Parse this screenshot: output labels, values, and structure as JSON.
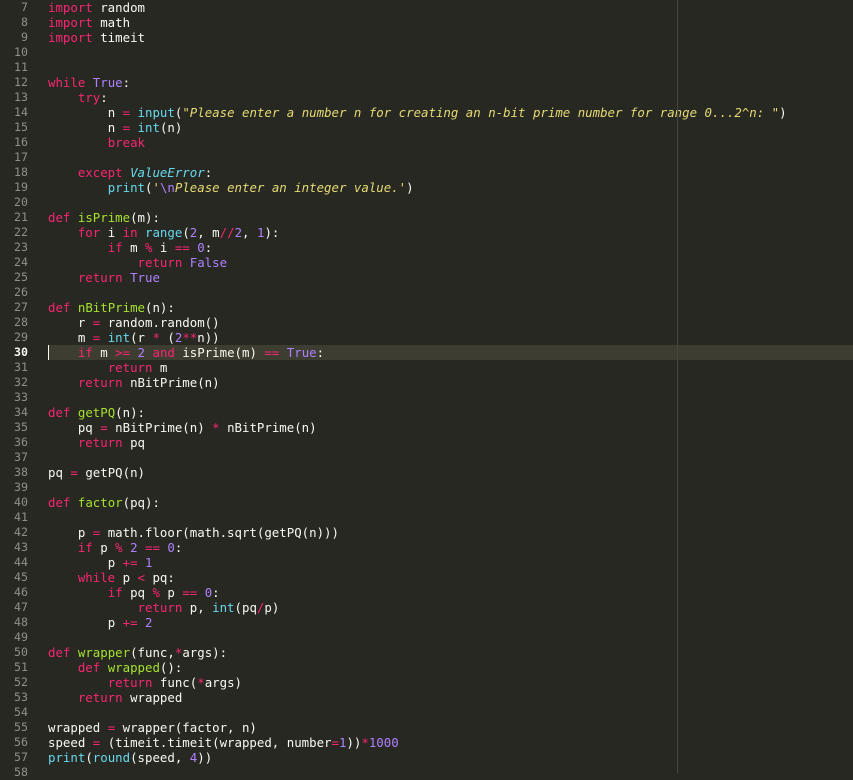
{
  "editor": {
    "active_line_number": "30",
    "colors": {
      "background": "#272822",
      "line_highlight": "#3e3d32",
      "gutter_text": "#90908a",
      "keyword": "#f92672",
      "string": "#e6db74",
      "number": "#ae81ff",
      "builtin": "#66d9ef",
      "function_name": "#a6e22e",
      "plain": "#f8f8f2"
    },
    "lines": [
      {
        "num": "7",
        "indent": 0,
        "tokens": [
          {
            "c": "k",
            "t": "import"
          },
          {
            "c": "t",
            "t": " random"
          }
        ]
      },
      {
        "num": "8",
        "indent": 0,
        "tokens": [
          {
            "c": "k",
            "t": "import"
          },
          {
            "c": "t",
            "t": " math"
          }
        ]
      },
      {
        "num": "9",
        "indent": 0,
        "tokens": [
          {
            "c": "k",
            "t": "import"
          },
          {
            "c": "t",
            "t": " timeit"
          }
        ]
      },
      {
        "num": "10",
        "indent": 0,
        "tokens": []
      },
      {
        "num": "11",
        "indent": 0,
        "tokens": []
      },
      {
        "num": "12",
        "indent": 0,
        "tokens": [
          {
            "c": "k",
            "t": "while"
          },
          {
            "c": "t",
            "t": " "
          },
          {
            "c": "n",
            "t": "True"
          },
          {
            "c": "t",
            "t": ":"
          }
        ]
      },
      {
        "num": "13",
        "indent": 1,
        "tokens": [
          {
            "c": "k",
            "t": "try"
          },
          {
            "c": "t",
            "t": ":"
          }
        ]
      },
      {
        "num": "14",
        "indent": 2,
        "tokens": [
          {
            "c": "t",
            "t": "n "
          },
          {
            "c": "k",
            "t": "="
          },
          {
            "c": "t",
            "t": " "
          },
          {
            "c": "b",
            "t": "input"
          },
          {
            "c": "t",
            "t": "("
          },
          {
            "c": "s",
            "t": "\""
          },
          {
            "c": "i",
            "t": "Please enter a number n for creating an n-bit prime number for range 0...2^n: "
          },
          {
            "c": "s",
            "t": "\""
          },
          {
            "c": "t",
            "t": ")"
          }
        ]
      },
      {
        "num": "15",
        "indent": 2,
        "tokens": [
          {
            "c": "t",
            "t": "n "
          },
          {
            "c": "k",
            "t": "="
          },
          {
            "c": "t",
            "t": " "
          },
          {
            "c": "b",
            "t": "int"
          },
          {
            "c": "t",
            "t": "(n)"
          }
        ]
      },
      {
        "num": "16",
        "indent": 2,
        "tokens": [
          {
            "c": "k",
            "t": "break"
          }
        ]
      },
      {
        "num": "17",
        "indent": 0,
        "tokens": []
      },
      {
        "num": "18",
        "indent": 1,
        "tokens": [
          {
            "c": "k",
            "t": "except"
          },
          {
            "c": "t",
            "t": " "
          },
          {
            "c": "d",
            "t": "ValueError"
          },
          {
            "c": "t",
            "t": ":"
          }
        ]
      },
      {
        "num": "19",
        "indent": 2,
        "tokens": [
          {
            "c": "b",
            "t": "print"
          },
          {
            "c": "t",
            "t": "("
          },
          {
            "c": "s",
            "t": "'"
          },
          {
            "c": "n",
            "t": "\\n"
          },
          {
            "c": "i",
            "t": "Please enter an integer value."
          },
          {
            "c": "s",
            "t": "'"
          },
          {
            "c": "t",
            "t": ")"
          }
        ]
      },
      {
        "num": "20",
        "indent": 0,
        "tokens": []
      },
      {
        "num": "21",
        "indent": 0,
        "tokens": [
          {
            "c": "k",
            "t": "def"
          },
          {
            "c": "t",
            "t": " "
          },
          {
            "c": "f",
            "t": "isPrime"
          },
          {
            "c": "t",
            "t": "(m):"
          }
        ]
      },
      {
        "num": "22",
        "indent": 1,
        "tokens": [
          {
            "c": "k",
            "t": "for"
          },
          {
            "c": "t",
            "t": " i "
          },
          {
            "c": "k",
            "t": "in"
          },
          {
            "c": "t",
            "t": " "
          },
          {
            "c": "b",
            "t": "range"
          },
          {
            "c": "t",
            "t": "("
          },
          {
            "c": "n",
            "t": "2"
          },
          {
            "c": "t",
            "t": ", m"
          },
          {
            "c": "k",
            "t": "//"
          },
          {
            "c": "n",
            "t": "2"
          },
          {
            "c": "t",
            "t": ", "
          },
          {
            "c": "n",
            "t": "1"
          },
          {
            "c": "t",
            "t": "):"
          }
        ]
      },
      {
        "num": "23",
        "indent": 2,
        "tokens": [
          {
            "c": "k",
            "t": "if"
          },
          {
            "c": "t",
            "t": " m "
          },
          {
            "c": "k",
            "t": "%"
          },
          {
            "c": "t",
            "t": " i "
          },
          {
            "c": "k",
            "t": "=="
          },
          {
            "c": "t",
            "t": " "
          },
          {
            "c": "n",
            "t": "0"
          },
          {
            "c": "t",
            "t": ":"
          }
        ]
      },
      {
        "num": "24",
        "indent": 3,
        "tokens": [
          {
            "c": "k",
            "t": "return"
          },
          {
            "c": "t",
            "t": " "
          },
          {
            "c": "n",
            "t": "False"
          }
        ]
      },
      {
        "num": "25",
        "indent": 1,
        "tokens": [
          {
            "c": "k",
            "t": "return"
          },
          {
            "c": "t",
            "t": " "
          },
          {
            "c": "n",
            "t": "True"
          }
        ]
      },
      {
        "num": "26",
        "indent": 0,
        "tokens": []
      },
      {
        "num": "27",
        "indent": 0,
        "tokens": [
          {
            "c": "k",
            "t": "def"
          },
          {
            "c": "t",
            "t": " "
          },
          {
            "c": "f",
            "t": "nBitPrime"
          },
          {
            "c": "t",
            "t": "(n):"
          }
        ]
      },
      {
        "num": "28",
        "indent": 1,
        "tokens": [
          {
            "c": "t",
            "t": "r "
          },
          {
            "c": "k",
            "t": "="
          },
          {
            "c": "t",
            "t": " random.random()"
          }
        ]
      },
      {
        "num": "29",
        "indent": 1,
        "tokens": [
          {
            "c": "t",
            "t": "m "
          },
          {
            "c": "k",
            "t": "="
          },
          {
            "c": "t",
            "t": " "
          },
          {
            "c": "b",
            "t": "int"
          },
          {
            "c": "t",
            "t": "(r "
          },
          {
            "c": "k",
            "t": "*"
          },
          {
            "c": "t",
            "t": " ("
          },
          {
            "c": "n",
            "t": "2"
          },
          {
            "c": "k",
            "t": "**"
          },
          {
            "c": "t",
            "t": "n))"
          }
        ]
      },
      {
        "num": "30",
        "indent": 1,
        "tokens": [
          {
            "c": "k",
            "t": "if"
          },
          {
            "c": "t",
            "t": " m "
          },
          {
            "c": "k",
            "t": ">="
          },
          {
            "c": "t",
            "t": " "
          },
          {
            "c": "n",
            "t": "2"
          },
          {
            "c": "t",
            "t": " "
          },
          {
            "c": "k",
            "t": "and"
          },
          {
            "c": "t",
            "t": " isPrime(m) "
          },
          {
            "c": "k",
            "t": "=="
          },
          {
            "c": "t",
            "t": " "
          },
          {
            "c": "n",
            "t": "True"
          },
          {
            "c": "t",
            "t": ":"
          }
        ]
      },
      {
        "num": "31",
        "indent": 2,
        "tokens": [
          {
            "c": "k",
            "t": "return"
          },
          {
            "c": "t",
            "t": " m"
          }
        ]
      },
      {
        "num": "32",
        "indent": 1,
        "tokens": [
          {
            "c": "k",
            "t": "return"
          },
          {
            "c": "t",
            "t": " nBitPrime(n)"
          }
        ]
      },
      {
        "num": "33",
        "indent": 0,
        "tokens": []
      },
      {
        "num": "34",
        "indent": 0,
        "tokens": [
          {
            "c": "k",
            "t": "def"
          },
          {
            "c": "t",
            "t": " "
          },
          {
            "c": "f",
            "t": "getPQ"
          },
          {
            "c": "t",
            "t": "(n):"
          }
        ]
      },
      {
        "num": "35",
        "indent": 1,
        "tokens": [
          {
            "c": "t",
            "t": "pq "
          },
          {
            "c": "k",
            "t": "="
          },
          {
            "c": "t",
            "t": " nBitPrime(n) "
          },
          {
            "c": "k",
            "t": "*"
          },
          {
            "c": "t",
            "t": " nBitPrime(n)"
          }
        ]
      },
      {
        "num": "36",
        "indent": 1,
        "tokens": [
          {
            "c": "k",
            "t": "return"
          },
          {
            "c": "t",
            "t": " pq"
          }
        ]
      },
      {
        "num": "37",
        "indent": 0,
        "tokens": []
      },
      {
        "num": "38",
        "indent": 0,
        "tokens": [
          {
            "c": "t",
            "t": "pq "
          },
          {
            "c": "k",
            "t": "="
          },
          {
            "c": "t",
            "t": " getPQ(n)"
          }
        ]
      },
      {
        "num": "39",
        "indent": 0,
        "tokens": []
      },
      {
        "num": "40",
        "indent": 0,
        "tokens": [
          {
            "c": "k",
            "t": "def"
          },
          {
            "c": "t",
            "t": " "
          },
          {
            "c": "f",
            "t": "factor"
          },
          {
            "c": "t",
            "t": "(pq):"
          }
        ]
      },
      {
        "num": "41",
        "indent": 0,
        "tokens": []
      },
      {
        "num": "42",
        "indent": 1,
        "tokens": [
          {
            "c": "t",
            "t": "p "
          },
          {
            "c": "k",
            "t": "="
          },
          {
            "c": "t",
            "t": " math.floor(math.sqrt(getPQ(n)))"
          }
        ]
      },
      {
        "num": "43",
        "indent": 1,
        "tokens": [
          {
            "c": "k",
            "t": "if"
          },
          {
            "c": "t",
            "t": " p "
          },
          {
            "c": "k",
            "t": "%"
          },
          {
            "c": "t",
            "t": " "
          },
          {
            "c": "n",
            "t": "2"
          },
          {
            "c": "t",
            "t": " "
          },
          {
            "c": "k",
            "t": "=="
          },
          {
            "c": "t",
            "t": " "
          },
          {
            "c": "n",
            "t": "0"
          },
          {
            "c": "t",
            "t": ":"
          }
        ]
      },
      {
        "num": "44",
        "indent": 2,
        "tokens": [
          {
            "c": "t",
            "t": "p "
          },
          {
            "c": "k",
            "t": "+="
          },
          {
            "c": "t",
            "t": " "
          },
          {
            "c": "n",
            "t": "1"
          }
        ]
      },
      {
        "num": "45",
        "indent": 1,
        "tokens": [
          {
            "c": "k",
            "t": "while"
          },
          {
            "c": "t",
            "t": " p "
          },
          {
            "c": "k",
            "t": "<"
          },
          {
            "c": "t",
            "t": " pq:"
          }
        ]
      },
      {
        "num": "46",
        "indent": 2,
        "tokens": [
          {
            "c": "k",
            "t": "if"
          },
          {
            "c": "t",
            "t": " pq "
          },
          {
            "c": "k",
            "t": "%"
          },
          {
            "c": "t",
            "t": " p "
          },
          {
            "c": "k",
            "t": "=="
          },
          {
            "c": "t",
            "t": " "
          },
          {
            "c": "n",
            "t": "0"
          },
          {
            "c": "t",
            "t": ":"
          }
        ]
      },
      {
        "num": "47",
        "indent": 3,
        "tokens": [
          {
            "c": "k",
            "t": "return"
          },
          {
            "c": "t",
            "t": " p, "
          },
          {
            "c": "b",
            "t": "int"
          },
          {
            "c": "t",
            "t": "(pq"
          },
          {
            "c": "k",
            "t": "/"
          },
          {
            "c": "t",
            "t": "p)"
          }
        ]
      },
      {
        "num": "48",
        "indent": 2,
        "tokens": [
          {
            "c": "t",
            "t": "p "
          },
          {
            "c": "k",
            "t": "+="
          },
          {
            "c": "t",
            "t": " "
          },
          {
            "c": "n",
            "t": "2"
          }
        ]
      },
      {
        "num": "49",
        "indent": 0,
        "tokens": []
      },
      {
        "num": "50",
        "indent": 0,
        "tokens": [
          {
            "c": "k",
            "t": "def"
          },
          {
            "c": "t",
            "t": " "
          },
          {
            "c": "f",
            "t": "wrapper"
          },
          {
            "c": "t",
            "t": "(func,"
          },
          {
            "c": "k",
            "t": "*"
          },
          {
            "c": "t",
            "t": "args):"
          }
        ]
      },
      {
        "num": "51",
        "indent": 1,
        "tokens": [
          {
            "c": "k",
            "t": "def"
          },
          {
            "c": "t",
            "t": " "
          },
          {
            "c": "f",
            "t": "wrapped"
          },
          {
            "c": "t",
            "t": "():"
          }
        ]
      },
      {
        "num": "52",
        "indent": 2,
        "tokens": [
          {
            "c": "k",
            "t": "return"
          },
          {
            "c": "t",
            "t": " func("
          },
          {
            "c": "k",
            "t": "*"
          },
          {
            "c": "t",
            "t": "args)"
          }
        ]
      },
      {
        "num": "53",
        "indent": 1,
        "tokens": [
          {
            "c": "k",
            "t": "return"
          },
          {
            "c": "t",
            "t": " wrapped"
          }
        ]
      },
      {
        "num": "54",
        "indent": 0,
        "tokens": []
      },
      {
        "num": "55",
        "indent": 0,
        "tokens": [
          {
            "c": "t",
            "t": "wrapped "
          },
          {
            "c": "k",
            "t": "="
          },
          {
            "c": "t",
            "t": " wrapper(factor, n)"
          }
        ]
      },
      {
        "num": "56",
        "indent": 0,
        "tokens": [
          {
            "c": "t",
            "t": "speed "
          },
          {
            "c": "k",
            "t": "="
          },
          {
            "c": "t",
            "t": " (timeit.timeit(wrapped, number"
          },
          {
            "c": "k",
            "t": "="
          },
          {
            "c": "n",
            "t": "1"
          },
          {
            "c": "t",
            "t": "))"
          },
          {
            "c": "k",
            "t": "*"
          },
          {
            "c": "n",
            "t": "1000"
          }
        ]
      },
      {
        "num": "57",
        "indent": 0,
        "tokens": [
          {
            "c": "b",
            "t": "print"
          },
          {
            "c": "t",
            "t": "("
          },
          {
            "c": "b",
            "t": "round"
          },
          {
            "c": "t",
            "t": "(speed, "
          },
          {
            "c": "n",
            "t": "4"
          },
          {
            "c": "t",
            "t": "))"
          }
        ]
      },
      {
        "num": "58",
        "indent": 0,
        "tokens": []
      }
    ]
  }
}
